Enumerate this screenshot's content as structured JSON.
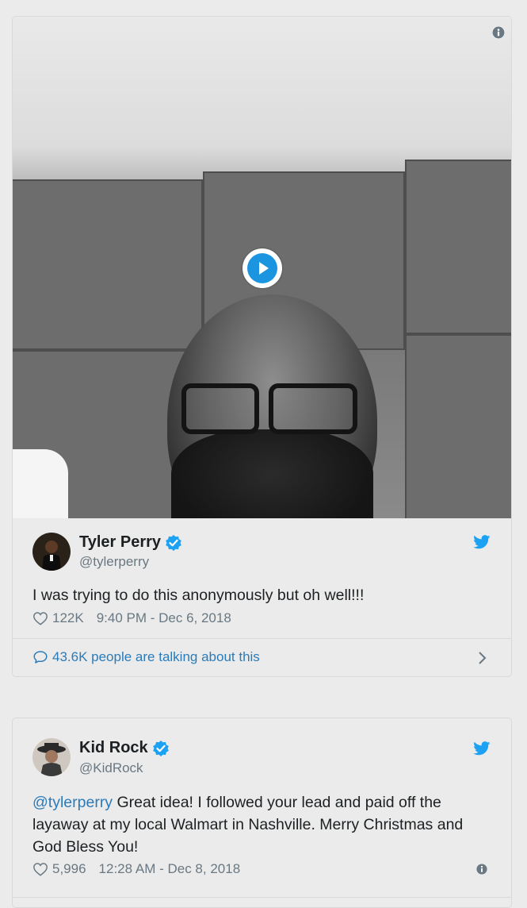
{
  "tweets": [
    {
      "name": "Tyler Perry",
      "handle": "@tylerperry",
      "text": "I was trying to do this anonymously but oh well!!!",
      "likes": "122K",
      "time": "9:40 PM - Dec 6, 2018",
      "talking": "43.6K people are talking about this",
      "media": "video",
      "verified": true
    },
    {
      "name": "Kid Rock",
      "handle": "@KidRock",
      "mention": "@tylerperry",
      "text": " Great idea! I followed your lead and paid off the layaway at my local Walmart in Nashville.  Merry Christmas and God Bless You!",
      "likes": "5,996",
      "time": "12:28 AM - Dec 8, 2018",
      "verified": true
    }
  ],
  "icons": {
    "play": "play-icon",
    "info": "info-icon",
    "verified": "verified-badge-icon",
    "twitter": "twitter-bird-icon",
    "heart": "heart-icon",
    "comment": "comment-icon",
    "chevron": "chevron-right-icon"
  },
  "colors": {
    "link": "#2b7bb9",
    "twitter_blue": "#1da1f2",
    "secondary_text": "#697882",
    "background": "#ebebeb"
  }
}
